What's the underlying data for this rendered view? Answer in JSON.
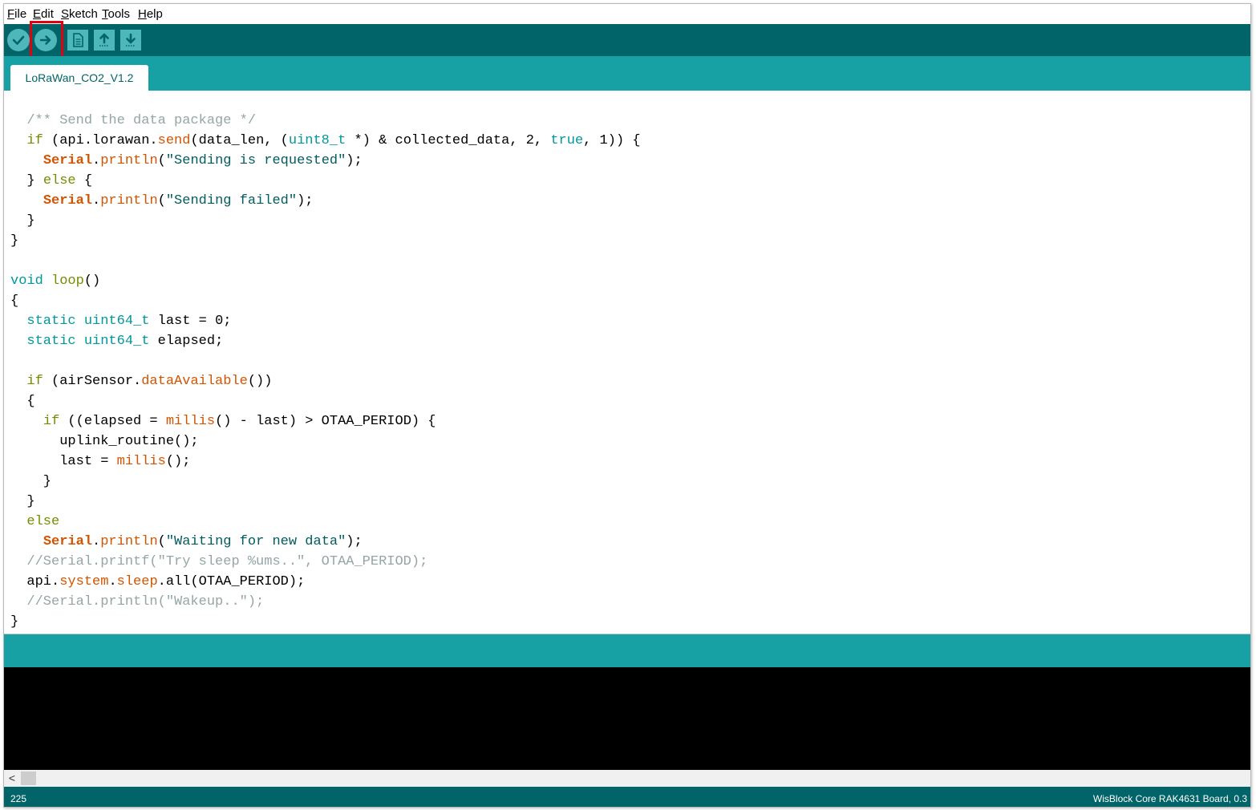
{
  "menu": {
    "items": [
      {
        "accel": "F",
        "rest": "ile"
      },
      {
        "accel": "E",
        "rest": "dit"
      },
      {
        "accel": "S",
        "rest": "ketch"
      },
      {
        "accel": "T",
        "rest": "ools"
      },
      {
        "accel": "H",
        "rest": "elp"
      }
    ]
  },
  "toolbar": {
    "icons": {
      "verify": "checkmark-icon",
      "upload": "arrow-right-icon",
      "new": "document-icon",
      "open": "arrow-up-icon",
      "save": "arrow-down-icon"
    },
    "highlight_color": "#e3000f"
  },
  "tabs": [
    {
      "label": "LoRaWan_CO2_V1.2",
      "active": true
    }
  ],
  "editor": {
    "lines": [
      [
        [
          "  ",
          ""
        ],
        [
          "/** Send the data package */",
          "cmt"
        ]
      ],
      [
        [
          "  ",
          ""
        ],
        [
          "if",
          "kw"
        ],
        [
          " (api.lorawan.",
          ""
        ],
        [
          "send",
          "fn"
        ],
        [
          "(data_len, (",
          ""
        ],
        [
          "uint8_t",
          "ty"
        ],
        [
          " *) & collected_data, 2, ",
          ""
        ],
        [
          "true",
          "ty"
        ],
        [
          ", 1)) {",
          ""
        ]
      ],
      [
        [
          "    ",
          ""
        ],
        [
          "Serial",
          "cls"
        ],
        [
          ".",
          ""
        ],
        [
          "println",
          "fn"
        ],
        [
          "(",
          ""
        ],
        [
          "\"Sending is requested\"",
          "str"
        ],
        [
          ");",
          ""
        ]
      ],
      [
        [
          "  } ",
          ""
        ],
        [
          "else",
          "kw"
        ],
        [
          " {",
          ""
        ]
      ],
      [
        [
          "    ",
          ""
        ],
        [
          "Serial",
          "cls"
        ],
        [
          ".",
          ""
        ],
        [
          "println",
          "fn"
        ],
        [
          "(",
          ""
        ],
        [
          "\"Sending failed\"",
          "str"
        ],
        [
          ");",
          ""
        ]
      ],
      [
        [
          "  }",
          ""
        ]
      ],
      [
        [
          "}",
          ""
        ]
      ],
      [
        [
          "",
          ""
        ]
      ],
      [
        [
          "void",
          "ty"
        ],
        [
          " ",
          ""
        ],
        [
          "loop",
          "kw"
        ],
        [
          "()",
          ""
        ]
      ],
      [
        [
          "{",
          ""
        ]
      ],
      [
        [
          "  ",
          ""
        ],
        [
          "static",
          "ty"
        ],
        [
          " ",
          ""
        ],
        [
          "uint64_t",
          "ty"
        ],
        [
          " last = 0;",
          ""
        ]
      ],
      [
        [
          "  ",
          ""
        ],
        [
          "static",
          "ty"
        ],
        [
          " ",
          ""
        ],
        [
          "uint64_t",
          "ty"
        ],
        [
          " elapsed;",
          ""
        ]
      ],
      [
        [
          "",
          ""
        ]
      ],
      [
        [
          "  ",
          ""
        ],
        [
          "if",
          "kw"
        ],
        [
          " (airSensor.",
          ""
        ],
        [
          "dataAvailable",
          "fn"
        ],
        [
          "())",
          ""
        ]
      ],
      [
        [
          "  {",
          ""
        ]
      ],
      [
        [
          "    ",
          ""
        ],
        [
          "if",
          "kw"
        ],
        [
          " ((elapsed = ",
          ""
        ],
        [
          "millis",
          "fn"
        ],
        [
          "() - last) > OTAA_PERIOD) {",
          ""
        ]
      ],
      [
        [
          "      uplink_routine();",
          ""
        ]
      ],
      [
        [
          "      last = ",
          ""
        ],
        [
          "millis",
          "fn"
        ],
        [
          "();",
          ""
        ]
      ],
      [
        [
          "    }",
          ""
        ]
      ],
      [
        [
          "  }",
          ""
        ]
      ],
      [
        [
          "  ",
          ""
        ],
        [
          "else",
          "kw"
        ]
      ],
      [
        [
          "    ",
          ""
        ],
        [
          "Serial",
          "cls"
        ],
        [
          ".",
          ""
        ],
        [
          "println",
          "fn"
        ],
        [
          "(",
          ""
        ],
        [
          "\"Waiting for new data\"",
          "str"
        ],
        [
          ");",
          ""
        ]
      ],
      [
        [
          "  //Serial.printf(\"Try sleep %ums..\", OTAA_PERIOD);",
          "cmt"
        ]
      ],
      [
        [
          "  api.",
          ""
        ],
        [
          "system",
          "fn"
        ],
        [
          ".",
          ""
        ],
        [
          "sleep",
          "fn"
        ],
        [
          ".all(OTAA_PERIOD);",
          ""
        ]
      ],
      [
        [
          "  //Serial.println(\"Wakeup..\");",
          "cmt"
        ]
      ],
      [
        [
          "}",
          ""
        ]
      ]
    ]
  },
  "scrollbar": {
    "left_arrow": "<"
  },
  "status": {
    "line_number": "225",
    "board": "WisBlock Core RAK4631 Board, 0.3"
  },
  "colors": {
    "toolbar": "#006468",
    "tabbar": "#17a1a5",
    "button": "#4db7bb",
    "console": "#000000"
  }
}
